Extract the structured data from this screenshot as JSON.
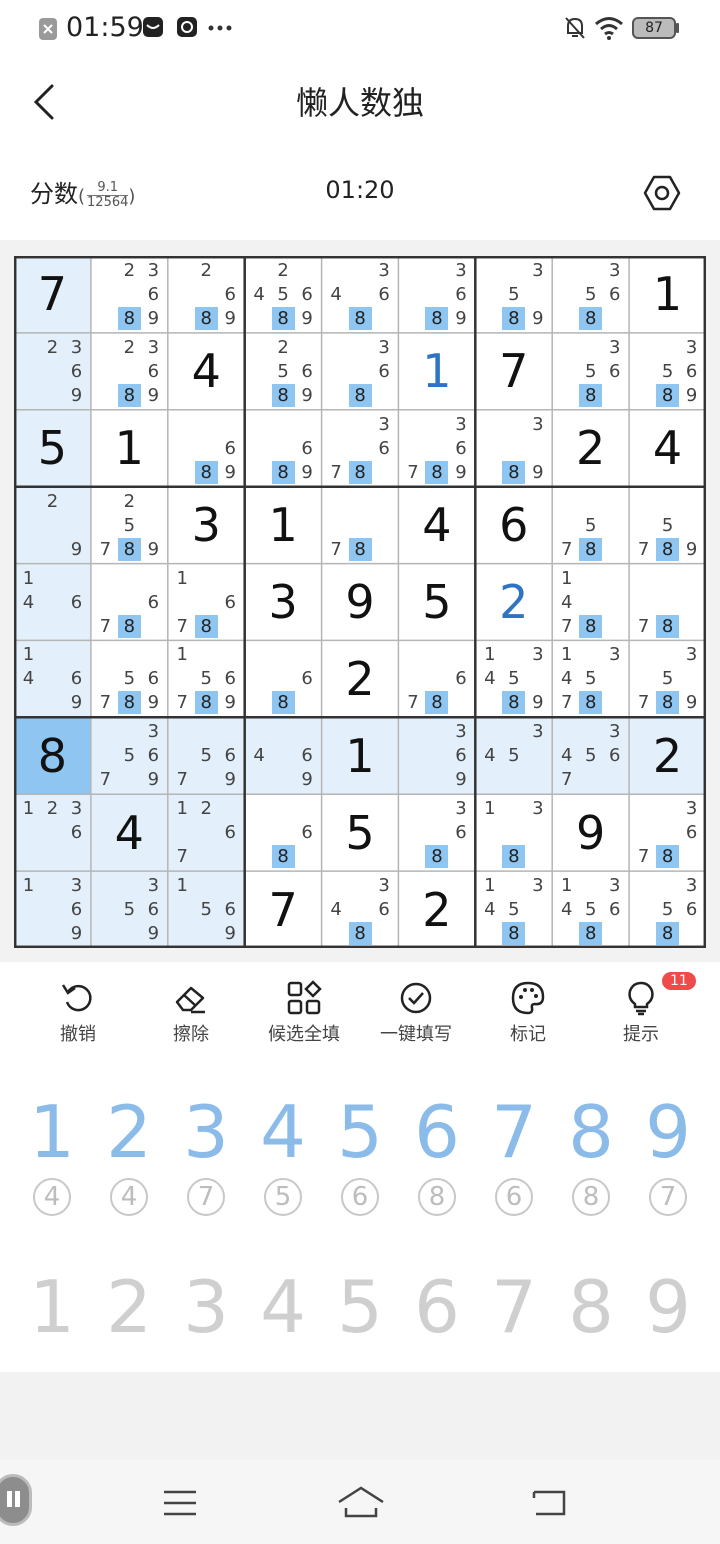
{
  "status_bar": {
    "time": "01:59",
    "battery": "87"
  },
  "header": {
    "title": "懒人数独",
    "score_label": "分数",
    "score_top": "9.1",
    "score_bottom": "12564",
    "timer": "01:20"
  },
  "board": {
    "cells": [
      [
        "7",
        [
          2,
          3,
          6,
          8,
          9
        ],
        [
          2,
          6,
          8,
          9
        ],
        [
          2,
          4,
          5,
          6,
          8,
          9
        ],
        [
          3,
          4,
          6,
          8
        ],
        [
          3,
          6,
          8,
          9
        ],
        [
          3,
          5,
          8,
          9
        ],
        [
          3,
          5,
          6,
          8
        ],
        "1"
      ],
      [
        [
          2,
          3,
          6,
          9
        ],
        [
          2,
          3,
          6,
          8,
          9
        ],
        "4",
        [
          2,
          5,
          6,
          8,
          9
        ],
        [
          3,
          6,
          8
        ],
        "1",
        "7",
        [
          3,
          5,
          6,
          8
        ],
        [
          3,
          5,
          6,
          8,
          9
        ]
      ],
      [
        "5",
        "1",
        [
          6,
          8,
          9
        ],
        [
          6,
          8,
          9
        ],
        [
          3,
          6,
          7,
          8
        ],
        [
          3,
          6,
          7,
          8,
          9
        ],
        [
          3,
          8,
          9
        ],
        "2",
        "4"
      ],
      [
        [
          2,
          9
        ],
        [
          2,
          5,
          7,
          8,
          9
        ],
        "3",
        "1",
        [
          7,
          8
        ],
        "4",
        "6",
        [
          5,
          7,
          8
        ],
        [
          5,
          7,
          8,
          9
        ]
      ],
      [
        [
          1,
          4,
          6
        ],
        [
          6,
          7,
          8
        ],
        [
          1,
          6,
          7,
          8
        ],
        "3",
        "9",
        "5",
        "2",
        [
          1,
          4,
          7,
          8
        ],
        [
          7,
          8
        ]
      ],
      [
        [
          1,
          4,
          6,
          9
        ],
        [
          5,
          6,
          7,
          8,
          9
        ],
        [
          1,
          5,
          6,
          7,
          8,
          9
        ],
        [
          6,
          8
        ],
        "2",
        [
          6,
          7,
          8
        ],
        [
          1,
          3,
          4,
          5,
          8,
          9
        ],
        [
          1,
          3,
          4,
          5,
          7,
          8
        ],
        [
          3,
          5,
          7,
          8,
          9
        ]
      ],
      [
        "8",
        [
          3,
          5,
          6,
          7,
          9
        ],
        [
          5,
          6,
          7,
          9
        ],
        [
          4,
          6,
          9
        ],
        "1",
        [
          3,
          6,
          9
        ],
        [
          3,
          4,
          5
        ],
        [
          3,
          4,
          5,
          6,
          7
        ],
        "2"
      ],
      [
        [
          1,
          2,
          3,
          6
        ],
        "4",
        [
          1,
          2,
          6,
          7
        ],
        [
          6,
          8
        ],
        "5",
        [
          3,
          6,
          8
        ],
        [
          1,
          3,
          8
        ],
        "9",
        [
          3,
          6,
          7,
          8
        ]
      ],
      [
        [
          1,
          3,
          6,
          9
        ],
        [
          3,
          5,
          6,
          9
        ],
        [
          1,
          5,
          6,
          9
        ],
        "7",
        [
          3,
          4,
          6,
          8
        ],
        "2",
        [
          1,
          3,
          4,
          5,
          8
        ],
        [
          1,
          3,
          4,
          5,
          6,
          8
        ],
        [
          3,
          5,
          6,
          8
        ]
      ]
    ],
    "user_filled": [
      [
        1,
        5
      ],
      [
        4,
        6
      ]
    ],
    "selected": [
      6,
      0
    ],
    "highlighted_candidate": 8
  },
  "toolbar": {
    "undo": "撤销",
    "erase": "擦除",
    "fill_candidates": "候选全填",
    "one_key_fill": "一键填写",
    "mark": "标记",
    "hint": "提示",
    "hint_badge": "11"
  },
  "number_pad": {
    "numbers": [
      "1",
      "2",
      "3",
      "4",
      "5",
      "6",
      "7",
      "8",
      "9"
    ],
    "remaining": [
      "4",
      "4",
      "7",
      "5",
      "6",
      "8",
      "6",
      "8",
      "7"
    ],
    "second_row": [
      "1",
      "2",
      "3",
      "4",
      "5",
      "6",
      "7",
      "8",
      "9"
    ]
  },
  "colors": {
    "highlight_candidate": "#8ec5f1",
    "selected_cell": "#8ec5f1",
    "related_cell": "#e3f0fb",
    "user_digit": "#2f74c4"
  }
}
